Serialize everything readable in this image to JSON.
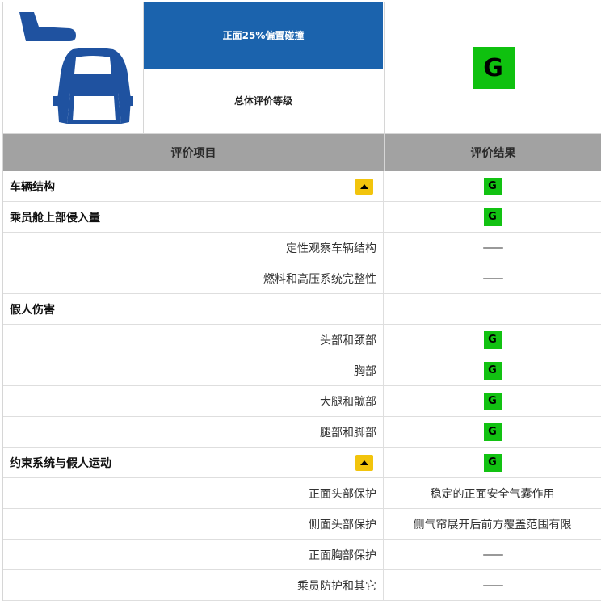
{
  "header": {
    "test_name": "正面25%偏置碰撞",
    "overall_label": "总体评价等级",
    "overall_rating": "G",
    "car_icon": "car-front-crash-icon"
  },
  "columns": {
    "item": "评价项目",
    "result": "评价结果"
  },
  "rows": [
    {
      "type": "cat",
      "label": "车辆结构",
      "flag": true,
      "result": "G",
      "result_type": "badge"
    },
    {
      "type": "cat",
      "label": "乘员舱上部侵入量",
      "flag": false,
      "result": "G",
      "result_type": "badge"
    },
    {
      "type": "sub",
      "label": "定性观察车辆结构",
      "result": "——",
      "result_type": "dash"
    },
    {
      "type": "sub",
      "label": "燃料和高压系统完整性",
      "result": "——",
      "result_type": "dash"
    },
    {
      "type": "cat",
      "label": "假人伤害",
      "flag": false,
      "result": "",
      "result_type": "none"
    },
    {
      "type": "sub",
      "label": "头部和颈部",
      "result": "G",
      "result_type": "badge"
    },
    {
      "type": "sub",
      "label": "胸部",
      "result": "G",
      "result_type": "badge"
    },
    {
      "type": "sub",
      "label": "大腿和髋部",
      "result": "G",
      "result_type": "badge"
    },
    {
      "type": "sub",
      "label": "腿部和脚部",
      "result": "G",
      "result_type": "badge"
    },
    {
      "type": "cat",
      "label": "约束系统与假人运动",
      "flag": true,
      "result": "G",
      "result_type": "badge"
    },
    {
      "type": "sub",
      "label": "正面头部保护",
      "result": "稳定的正面安全气囊作用",
      "result_type": "text"
    },
    {
      "type": "sub",
      "label": "侧面头部保护",
      "result": "侧气帘展开后前方覆盖范围有限",
      "result_type": "text"
    },
    {
      "type": "sub",
      "label": "正面胸部保护",
      "result": "——",
      "result_type": "dash"
    },
    {
      "type": "sub",
      "label": "乘员防护和其它",
      "result": "——",
      "result_type": "dash"
    }
  ],
  "colors": {
    "title_bg": "#1b63ad",
    "good": "#12c212",
    "flag": "#f2c40c",
    "header_gray": "#a2a2a2"
  }
}
